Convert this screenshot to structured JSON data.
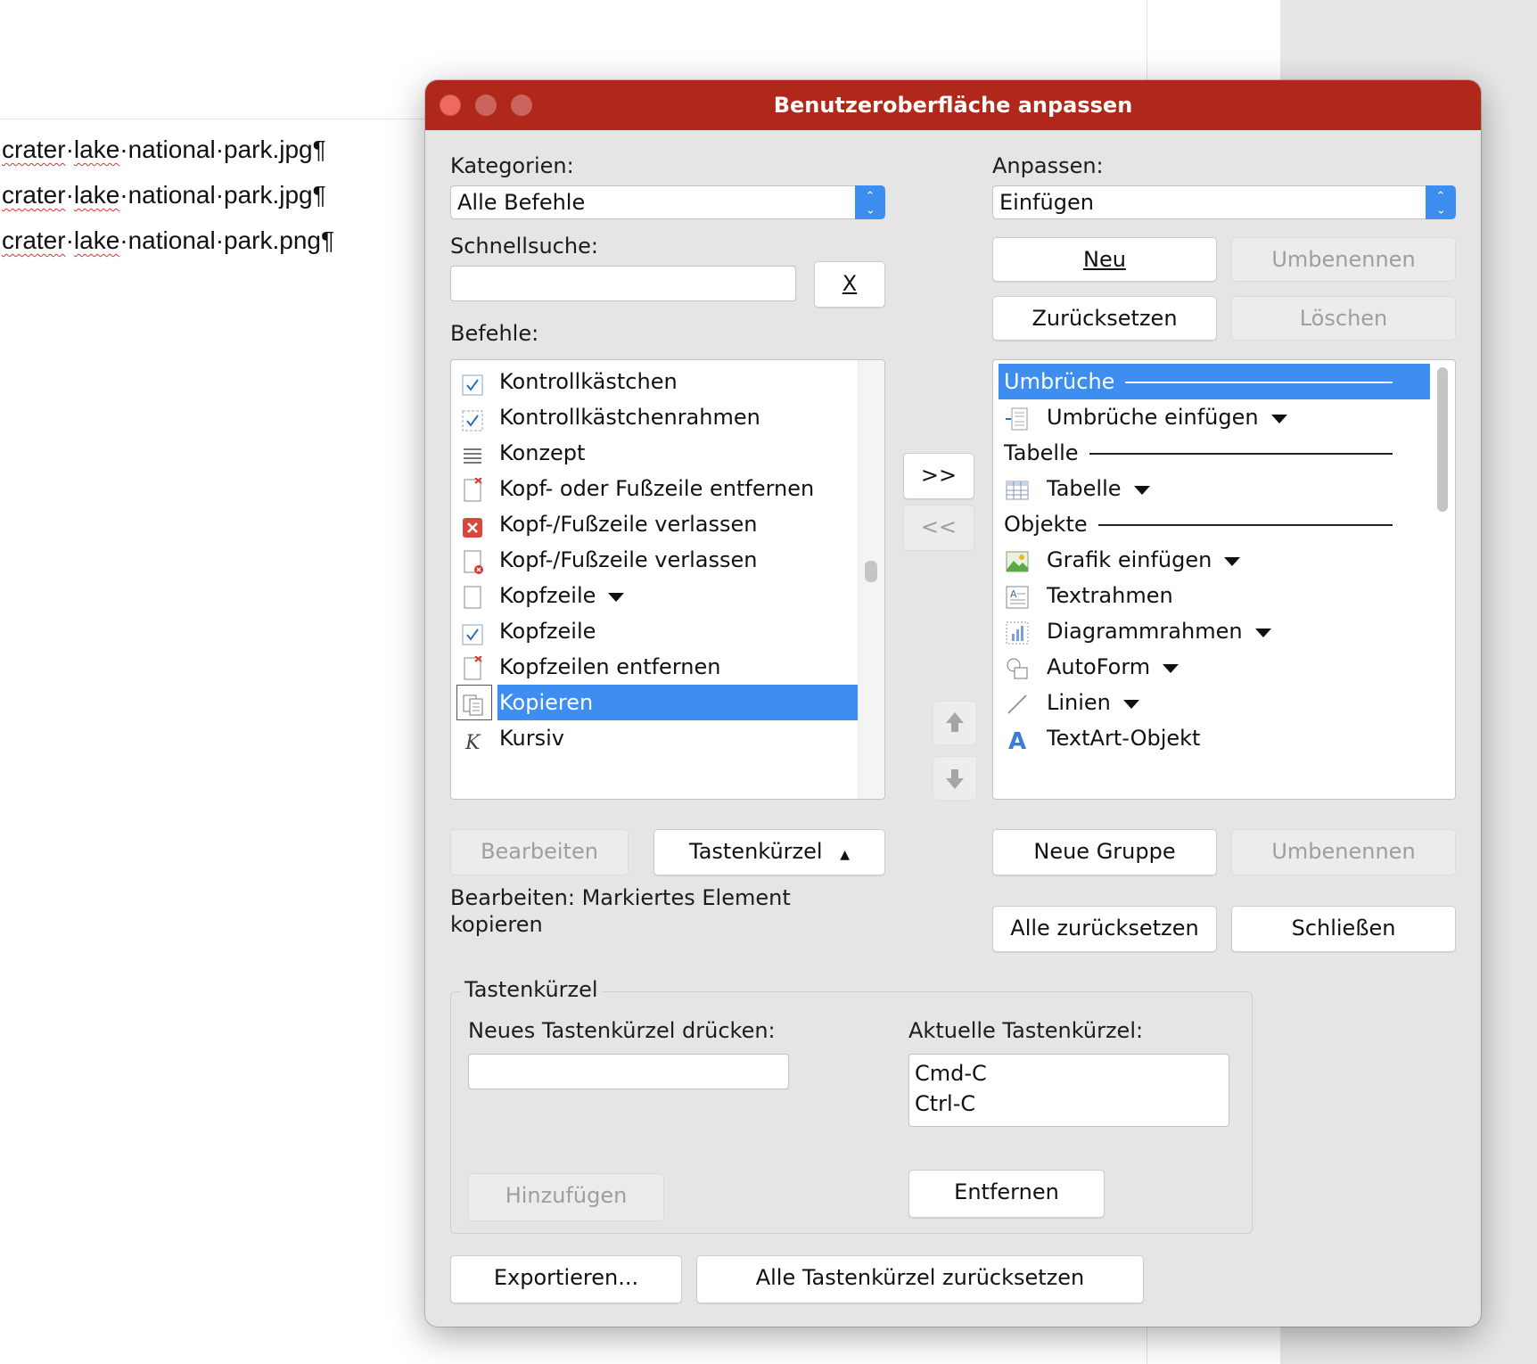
{
  "document": {
    "lines": [
      {
        "pre": "crater",
        "sep1": "·",
        "w2": "lake",
        "rest": "·national·park.jpg¶"
      },
      {
        "pre": "crater",
        "sep1": "·",
        "w2": "lake",
        "rest": "·national·park.jpg¶"
      },
      {
        "pre": "crater",
        "sep1": "·",
        "w2": "lake",
        "rest": "·national·park.png¶"
      }
    ]
  },
  "dialog": {
    "title": "Benutzeroberfläche anpassen",
    "categories_label": "Kategorien:",
    "categories_value": "Alle Befehle",
    "quicksearch_label": "Schnellsuche:",
    "quicksearch_value": "",
    "clear_button": "X",
    "commands_label": "Befehle:",
    "commands": [
      {
        "label": "Kontrollkästchen",
        "icon": "checkbox-icon",
        "dropdown": false
      },
      {
        "label": "Kontrollkästchenrahmen",
        "icon": "checkbox-frame-icon",
        "dropdown": false
      },
      {
        "label": "Konzept",
        "icon": "draft-lines-icon",
        "dropdown": false
      },
      {
        "label": "Kopf- oder Fußzeile entfernen",
        "icon": "remove-header-footer-icon",
        "dropdown": false
      },
      {
        "label": "Kopf-/Fußzeile verlassen",
        "icon": "close-red-icon",
        "dropdown": false
      },
      {
        "label": "Kopf-/Fußzeile verlassen",
        "icon": "page-close-icon",
        "dropdown": false
      },
      {
        "label": "Kopfzeile",
        "icon": "page-icon",
        "dropdown": true
      },
      {
        "label": "Kopfzeile",
        "icon": "checkbox-icon",
        "dropdown": false
      },
      {
        "label": "Kopfzeilen entfernen",
        "icon": "remove-header-icon",
        "dropdown": false
      },
      {
        "label": "Kopieren",
        "icon": "copy-icon",
        "dropdown": false,
        "selected": true
      },
      {
        "label": "Kursiv",
        "icon": "italic-icon",
        "dropdown": false
      }
    ],
    "add_button": ">>",
    "remove_button": "<<",
    "customize_label": "Anpassen:",
    "customize_value": "Einfügen",
    "new_button": "Neu",
    "rename_button": "Umbenennen",
    "reset_button": "Zurücksetzen",
    "delete_button": "Löschen",
    "menu_entries": [
      {
        "label": "Umbrüche",
        "type": "header",
        "selected": true
      },
      {
        "label": "Umbrüche einfügen",
        "icon": "break-insert-icon",
        "dropdown": true
      },
      {
        "label": "Tabelle",
        "type": "header"
      },
      {
        "label": "Tabelle",
        "icon": "table-icon",
        "dropdown": true
      },
      {
        "label": "Objekte",
        "type": "header"
      },
      {
        "label": "Grafik einfügen",
        "icon": "image-icon",
        "dropdown": true
      },
      {
        "label": "Textrahmen",
        "icon": "text-frame-icon",
        "dropdown": false
      },
      {
        "label": "Diagrammrahmen",
        "icon": "chart-icon",
        "dropdown": true
      },
      {
        "label": "AutoForm",
        "icon": "shapes-icon",
        "dropdown": true
      },
      {
        "label": "Linien",
        "icon": "line-icon",
        "dropdown": true
      },
      {
        "label": "TextArt-Objekt",
        "icon": "textart-icon",
        "dropdown": false
      }
    ],
    "edit_button": "Bearbeiten",
    "shortcut_button": "Tastenkürzel",
    "description": "Bearbeiten: Markiertes Element kopieren",
    "new_group_button": "Neue Gruppe",
    "rename_group_button": "Umbenennen",
    "reset_all_button": "Alle zurücksetzen",
    "close_button": "Schließen",
    "shortcut_group": {
      "title": "Tastenkürzel",
      "new_label": "Neues Tastenkürzel drücken:",
      "new_value": "",
      "current_label": "Aktuelle Tastenkürzel:",
      "current": [
        "Cmd-C",
        "Ctrl-C"
      ],
      "add_button": "Hinzufügen",
      "remove_button": "Entfernen"
    },
    "export_button": "Exportieren...",
    "reset_shortcuts_button": "Alle Tastenkürzel zurücksetzen"
  }
}
